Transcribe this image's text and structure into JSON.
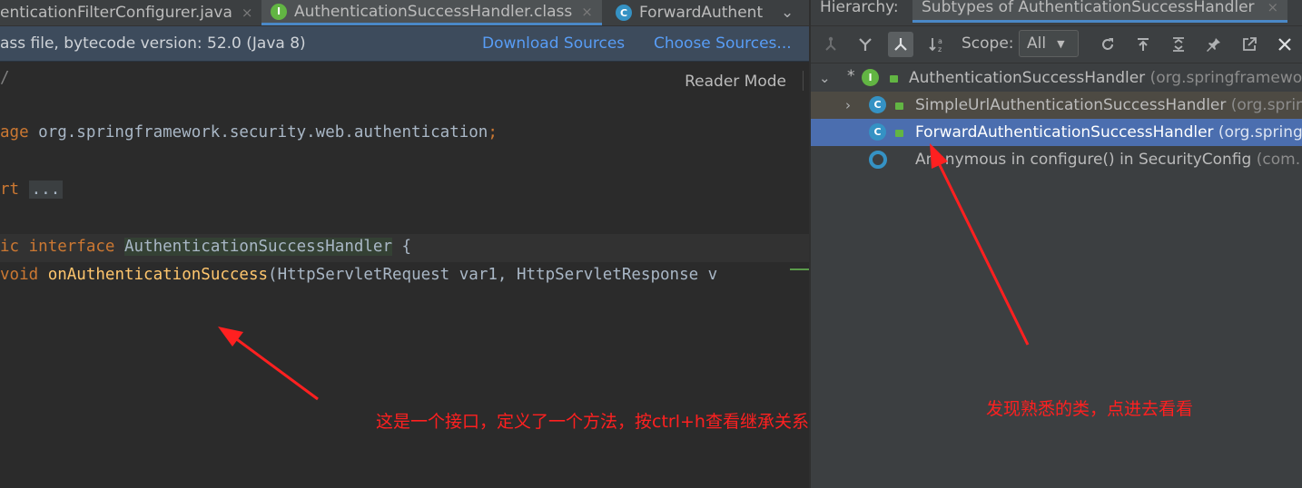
{
  "editor_tabs": [
    {
      "label": "enticationFilterConfigurer.java",
      "icon": "none",
      "close": "×"
    },
    {
      "label": "AuthenticationSuccessHandler.class",
      "icon": "I",
      "close": "×"
    },
    {
      "label": "ForwardAuthent",
      "icon": "C"
    }
  ],
  "banner": {
    "message": "ass file, bytecode version: 52.0 (Java 8)",
    "download_sources": "Download Sources",
    "choose_sources": "Choose Sources..."
  },
  "editor": {
    "reader_mode": "Reader Mode",
    "lines": {
      "comment_end": "/",
      "pkg_kw": "age",
      "pkg_name": " org.springframework.security.web.authentication",
      "pkg_semi": ";",
      "import_kw": "rt",
      "import_fold": "...",
      "iface_pub": "ic",
      "iface_kw": "interface",
      "iface_name": "AuthenticationSuccessHandler",
      "iface_brace": " {",
      "m_kw": "void",
      "m_name": "onAuthenticationSuccess",
      "m_params": "(HttpServletRequest var1, HttpServletResponse v"
    }
  },
  "hierarchy": {
    "title": "Hierarchy:",
    "tab": "Subtypes of AuthenticationSuccessHandler",
    "tab_close": "×",
    "scope_label": "Scope:",
    "scope_value": "All",
    "tree": [
      {
        "name": "AuthenticationSuccessHandler",
        "pkg": " (org.springframewo",
        "icon": "I",
        "expanded": true,
        "star": "*",
        "arrow": "⌄"
      },
      {
        "name": "SimpleUrlAuthenticationSuccessHandler",
        "pkg": " (org.sprin",
        "icon": "C",
        "arrow": "›"
      },
      {
        "name": "ForwardAuthenticationSuccessHandler",
        "pkg": " (org.spring",
        "icon": "C",
        "selected": true
      },
      {
        "name": "Anonymous in configure() in SecurityConfig",
        "pkg": " (com.",
        "icon": "anon"
      }
    ]
  },
  "annotations": {
    "left": "这是一个接口，定义了一个方法，按ctrl+h查看继承关系",
    "right": "发现熟悉的类，点进去看看"
  },
  "colors": {
    "accent": "#4a88c7",
    "selection": "#4b6eaf",
    "annotation": "#ff2020"
  }
}
